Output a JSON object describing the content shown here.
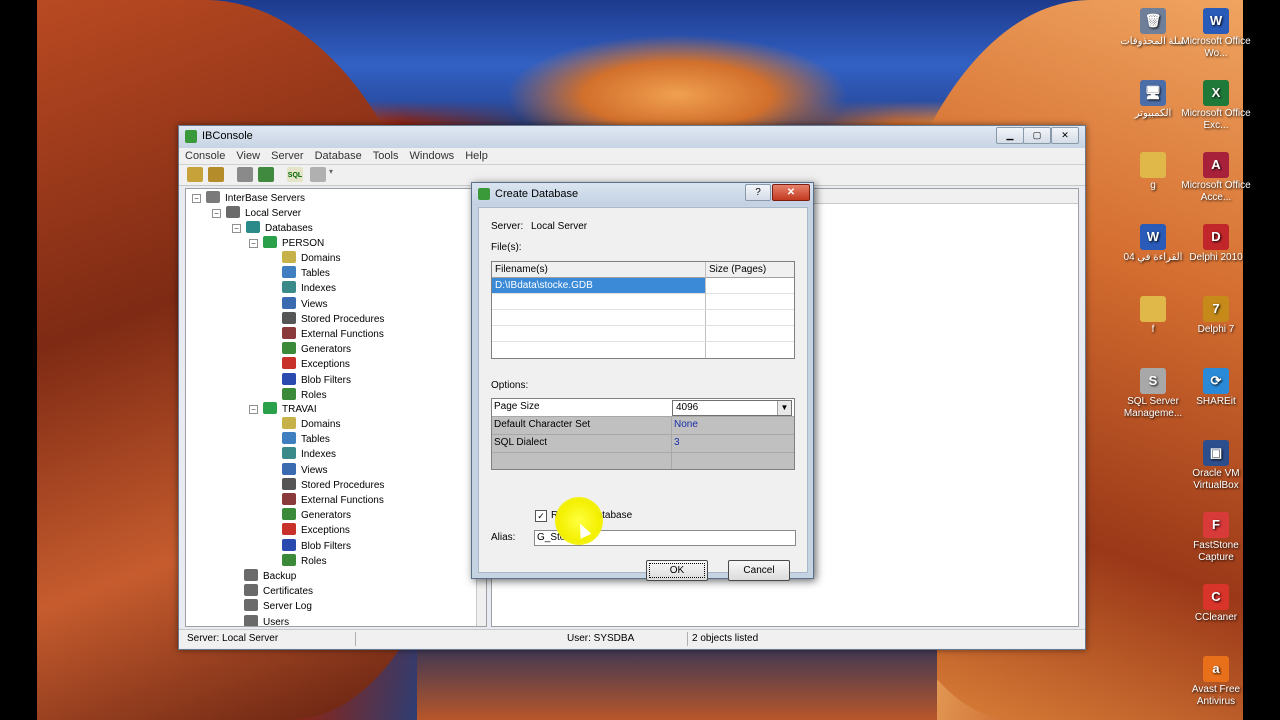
{
  "desktop": {
    "icons": [
      {
        "label": "سلة المحذوفات",
        "glyph": "🗑",
        "color": "#6f7f99"
      },
      {
        "label": "Microsoft Office Wo...",
        "glyph": "W",
        "color": "#2a5bb8"
      },
      {
        "label": "الكمبيوتر",
        "glyph": "🖥",
        "color": "#4b6ea8"
      },
      {
        "label": "Microsoft Office Exc...",
        "glyph": "X",
        "color": "#1f7a3a"
      },
      {
        "label": "g",
        "glyph": "",
        "color": "#e0b84a"
      },
      {
        "label": "Microsoft Office Acce...",
        "glyph": "A",
        "color": "#a8213a"
      },
      {
        "label": "القراءة في 04",
        "glyph": "W",
        "color": "#2a5bb8"
      },
      {
        "label": "Delphi 2010",
        "glyph": "D",
        "color": "#c0262a"
      },
      {
        "label": "f",
        "glyph": "",
        "color": "#e0b84a"
      },
      {
        "label": "Delphi 7",
        "glyph": "7",
        "color": "#c58a1a"
      },
      {
        "label": "SQL Server Manageme...",
        "glyph": "S",
        "color": "#a8a8a8"
      },
      {
        "label": "SHAREit",
        "glyph": "⟳",
        "color": "#2a8ad8"
      },
      {
        "label": "Oracle VM VirtualBox",
        "glyph": "▣",
        "color": "#2c4e8c"
      },
      {
        "label": "FastStone Capture",
        "glyph": "F",
        "color": "#d83a3a"
      },
      {
        "label": "CCleaner",
        "glyph": "C",
        "color": "#d8342a"
      },
      {
        "label": "Avast Free Antivirus",
        "glyph": "a",
        "color": "#e8701a"
      }
    ]
  },
  "window": {
    "title": "IBConsole",
    "menu": [
      "Console",
      "View",
      "Server",
      "Database",
      "Tools",
      "Windows",
      "Help"
    ],
    "toolbar_sql": "SQL",
    "tree": {
      "servers": "InterBase Servers",
      "local_server": "Local Server",
      "databases": "Databases",
      "db1": "PERSON",
      "db2": "TRAVAI",
      "children": [
        "Domains",
        "Tables",
        "Indexes",
        "Views",
        "Stored Procedures",
        "External Functions",
        "Generators",
        "Exceptions",
        "Blob Filters",
        "Roles"
      ],
      "bottom": [
        "Backup",
        "Certificates",
        "Server Log",
        "Users"
      ]
    },
    "status": {
      "server": "Server: Local Server",
      "user": "User: SYSDBA",
      "count": "2 objects listed"
    }
  },
  "dialog": {
    "title": "Create Database",
    "help": "?",
    "close": "✕",
    "server_label": "Server:",
    "server_value": "Local Server",
    "files_label": "File(s):",
    "col_filename": "Filename(s)",
    "col_size": "Size (Pages)",
    "filename": "D:\\IBdata\\stocke.GDB",
    "options_label": "Options:",
    "options": [
      {
        "key": "Page Size",
        "value": "4096"
      },
      {
        "key": "Default Character Set",
        "value": "None"
      },
      {
        "key": "SQL Dialect",
        "value": "3"
      }
    ],
    "register_label": "Register database",
    "register_checked": "✓",
    "alias_label": "Alias:",
    "alias_value": "G_Stock",
    "ok": "OK",
    "cancel": "Cancel"
  }
}
